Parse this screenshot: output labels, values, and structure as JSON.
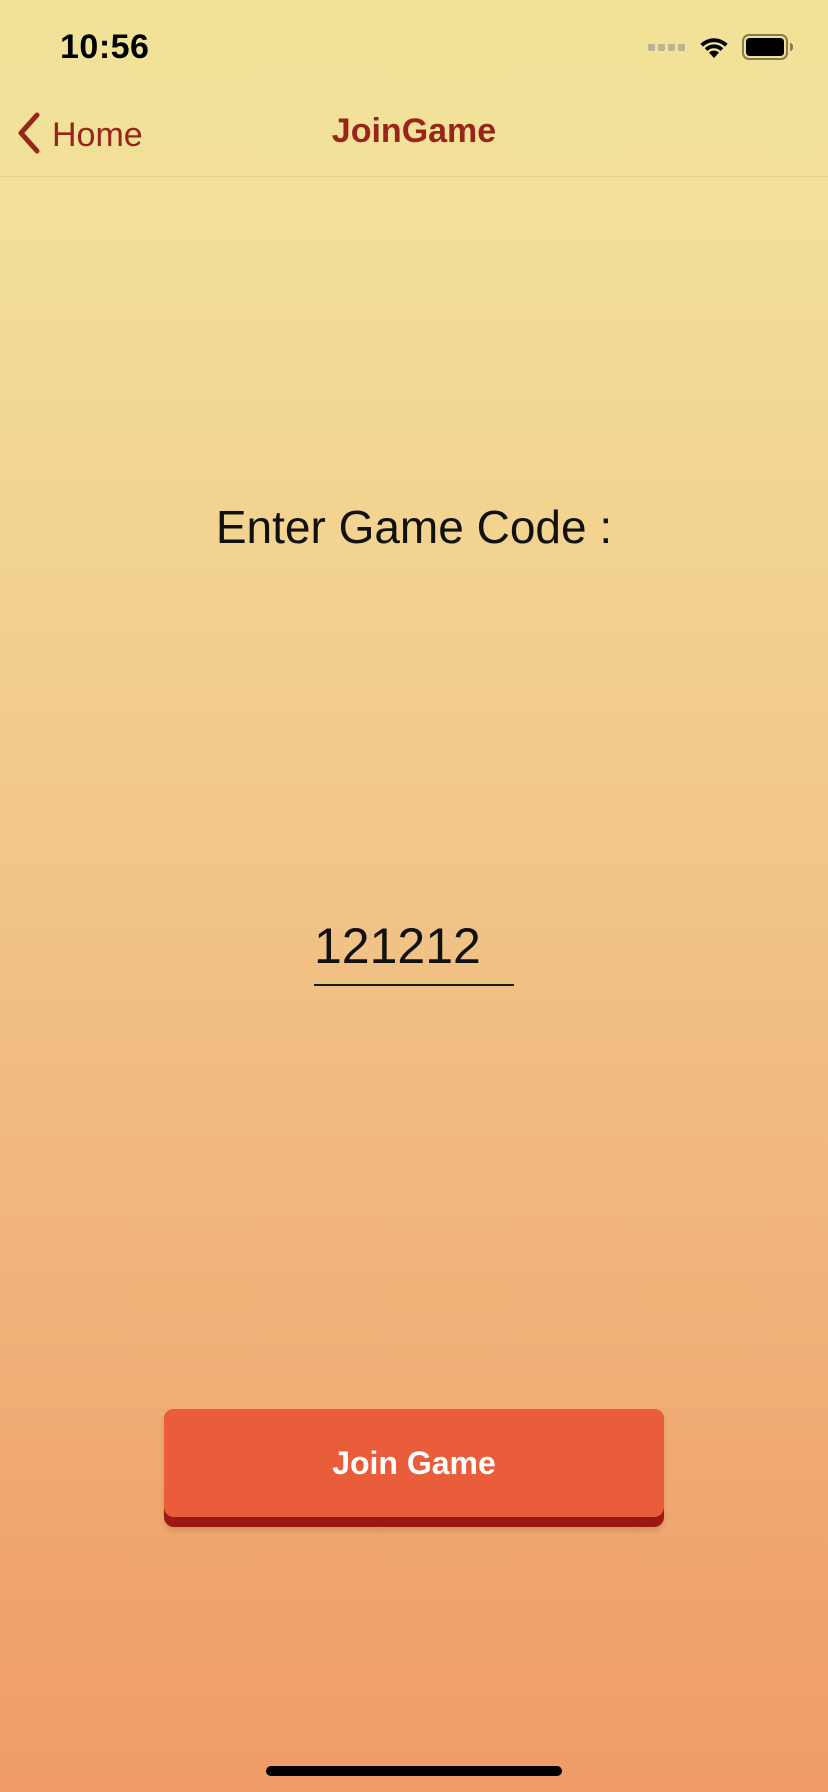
{
  "status_bar": {
    "time": "10:56",
    "icons": [
      "cellular-signal-icon",
      "wifi-icon",
      "battery-icon"
    ]
  },
  "nav": {
    "back_label": "Home",
    "title": "JoinGame"
  },
  "content": {
    "prompt": "Enter Game Code :",
    "code_value": "121212",
    "join_button_label": "Join Game"
  },
  "colors": {
    "accent": "#98251a",
    "button": "#e95d3a",
    "button_shadow": "#981a13",
    "gradient_top": "#f2e298",
    "gradient_bottom": "#f09b66"
  }
}
